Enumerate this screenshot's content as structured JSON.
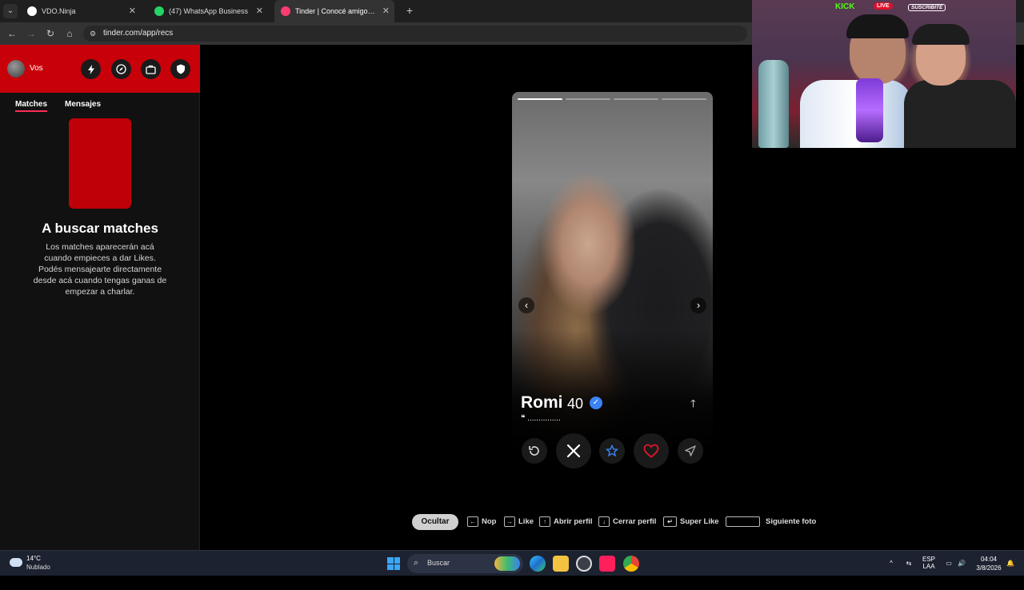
{
  "browser": {
    "tabs": [
      {
        "title": "VDO.Ninja",
        "favicon_color": "#ffffff"
      },
      {
        "title": "(47) WhatsApp Business",
        "favicon_color": "#25d366"
      },
      {
        "title": "Tinder | Conocé amigos y gente",
        "favicon_color": "#fe3c72"
      }
    ],
    "active_tab": 2,
    "close_glyph": "✕",
    "new_tab_glyph": "+",
    "url": "tinder.com/app/recs"
  },
  "sidebar": {
    "user_label": "Vos",
    "header_icons": [
      "bolt-icon",
      "compass-icon",
      "briefcase-icon",
      "shield-icon"
    ],
    "tabs": [
      "Matches",
      "Mensajes"
    ],
    "active_tab": "Matches",
    "empty_title": "A buscar matches",
    "empty_text": "Los matches aparecerán acá cuando empieces a dar Likes. Podés mensajearte directamente desde acá cuando tengas ganas de empezar a charlar."
  },
  "profile": {
    "name": "Romi",
    "age": "40",
    "verified": true,
    "bio": "❝ ...............",
    "photo_count": 4,
    "current_photo": 1
  },
  "actions": [
    "rewind-icon",
    "nope-icon",
    "super-like-icon",
    "like-icon",
    "boost-icon"
  ],
  "shortcuts": {
    "hide_label": "Ocultar",
    "items": [
      {
        "key": "←",
        "label": "Nop"
      },
      {
        "key": "→",
        "label": "Like"
      },
      {
        "key": "↑",
        "label": "Abrir perfil"
      },
      {
        "key": "↓",
        "label": "Cerrar perfil"
      },
      {
        "key": "↵",
        "label": "Super Like"
      },
      {
        "key": "",
        "label": "Siguiente foto"
      }
    ]
  },
  "webcam": {
    "kick_label": "KICK",
    "live_label": "LIVE",
    "subscribe_label": "SUSCRIBITE"
  },
  "taskbar": {
    "temperature": "14°C",
    "condition": "Nublado",
    "search_placeholder": "Buscar",
    "language": "ESP",
    "language_sub": "LAA",
    "time": "04:04",
    "date": "3/8/2026"
  },
  "colors": {
    "tinder_red": "#c8000a",
    "accent_pink": "#ff2b55",
    "verified_blue": "#3b82f6",
    "like_red": "#e0162b"
  }
}
